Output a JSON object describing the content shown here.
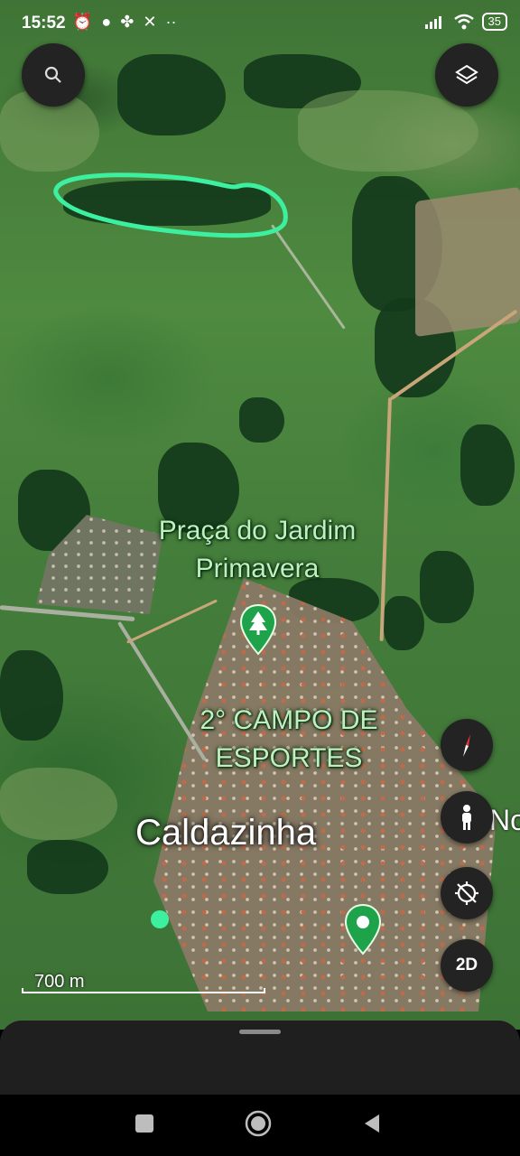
{
  "status_bar": {
    "time": "15:52",
    "left_icons": [
      "alarm-icon",
      "chat-bubble-icon",
      "pinwheel-icon",
      "x-app-icon",
      "more-dots-icon"
    ],
    "battery": "35",
    "right_icons": [
      "signal-icon",
      "wifi-icon",
      "battery-icon"
    ]
  },
  "map": {
    "place_labels": [
      {
        "name": "plaza-label",
        "text_line1": "Praça do Jardim",
        "text_line2": "Primavera"
      },
      {
        "name": "sports-field-label",
        "text_line1": "2° CAMPO DE",
        "text_line2": "ESPORTES"
      },
      {
        "name": "city-label",
        "text": "Caldazinha"
      },
      {
        "name": "partial-label",
        "text": "No"
      }
    ],
    "scale_text": "700 m",
    "annotation_color": "#3df0a0",
    "pin_color": "#1fa34a"
  },
  "controls": {
    "search_icon": "search-icon",
    "layers_icon": "layers-icon",
    "compass_icon": "compass-icon",
    "pegman_icon": "person-icon",
    "location_icon": "location-off-icon",
    "view_mode_label": "2D"
  }
}
